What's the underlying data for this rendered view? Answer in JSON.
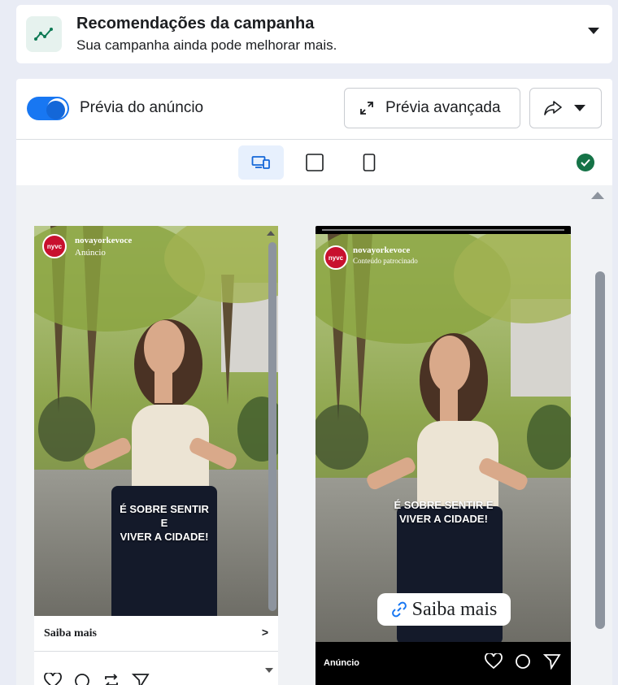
{
  "recommendations": {
    "title": "Recomendações da campanha",
    "subtitle": "Sua campanha ainda pode melhorar mais."
  },
  "toolbar": {
    "toggle_label": "Prévia do anúncio",
    "toggle_on": true,
    "advanced_preview_label": "Prévia avançada"
  },
  "placements": {
    "selected": "feed-and-stories"
  },
  "feed_ad": {
    "brand_initials": "nyvc",
    "account": "novayorkevoce",
    "sponsored": "Anúncio",
    "overlay_text_line1": "É SOBRE SENTIR E",
    "overlay_text_line2": "VIVER A CIDADE!",
    "cta_label": "Saiba mais",
    "cta_arrow": ">"
  },
  "story_ad": {
    "brand_initials": "nyvc",
    "account": "novayorkevoce",
    "sponsored": "Conteúdo patrocinado",
    "overlay_text_line1": "É SOBRE SENTIR E",
    "overlay_text_line2": "VIVER A CIDADE!",
    "cta_label": "Saiba mais",
    "footer_label": "Anúncio"
  },
  "colors": {
    "accent": "#1877f2",
    "success": "#157347",
    "brand_red": "#c8102e"
  }
}
